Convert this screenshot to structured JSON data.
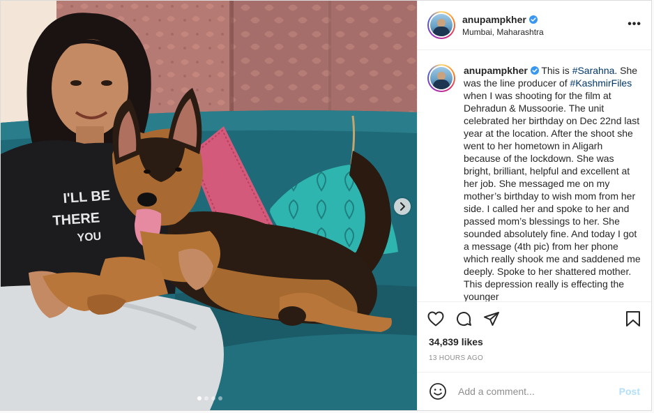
{
  "post": {
    "username": "anupampkher",
    "verified": true,
    "location": "Mumbai, Maharashtra",
    "more_icon": "more-options-icon",
    "more_label": "•••"
  },
  "caption": {
    "username": "anupampkher",
    "text_before_tag1": "This is ",
    "tag1": "#Sarahna",
    "text_between": ". She was the line producer of ",
    "tag2": "#KashmirFiles",
    "text_after": " when I was shooting for the film at Dehradun & Mussoorie. The unit celebrated her birthday on Dec 22nd last year at the location. After the shoot she went to her hometown in Aligarh because of the lockdown. She was bright, brilliant, helpful and excellent at her job. She messaged me on my mother’s birthday to wish mom from her side. I called her and spoke to her and passed mom’s blessings to her. She sounded absolutely fine. And today I got a message (4th pic) from her phone which really shook me and saddened me deeply. Spoke to her shattered mother. This depression really is effecting the younger"
  },
  "media": {
    "shirt_text_line1": "I'LL BE",
    "shirt_text_line2": "THERE",
    "shirt_text_line3": "YOU",
    "carousel_total": 4,
    "carousel_current": 1
  },
  "actions": {
    "like_icon": "heart-icon",
    "comment_icon": "comment-icon",
    "share_icon": "share-icon",
    "save_icon": "bookmark-icon"
  },
  "likes": "34,839 likes",
  "timestamp": "13 HOURS AGO",
  "comment_box": {
    "placeholder": "Add a comment...",
    "post_label": "Post"
  },
  "colors": {
    "link": "#00376b",
    "verified": "#3897f0",
    "post_button_disabled": "#b2dffc",
    "sofa": "#1f6a78"
  }
}
